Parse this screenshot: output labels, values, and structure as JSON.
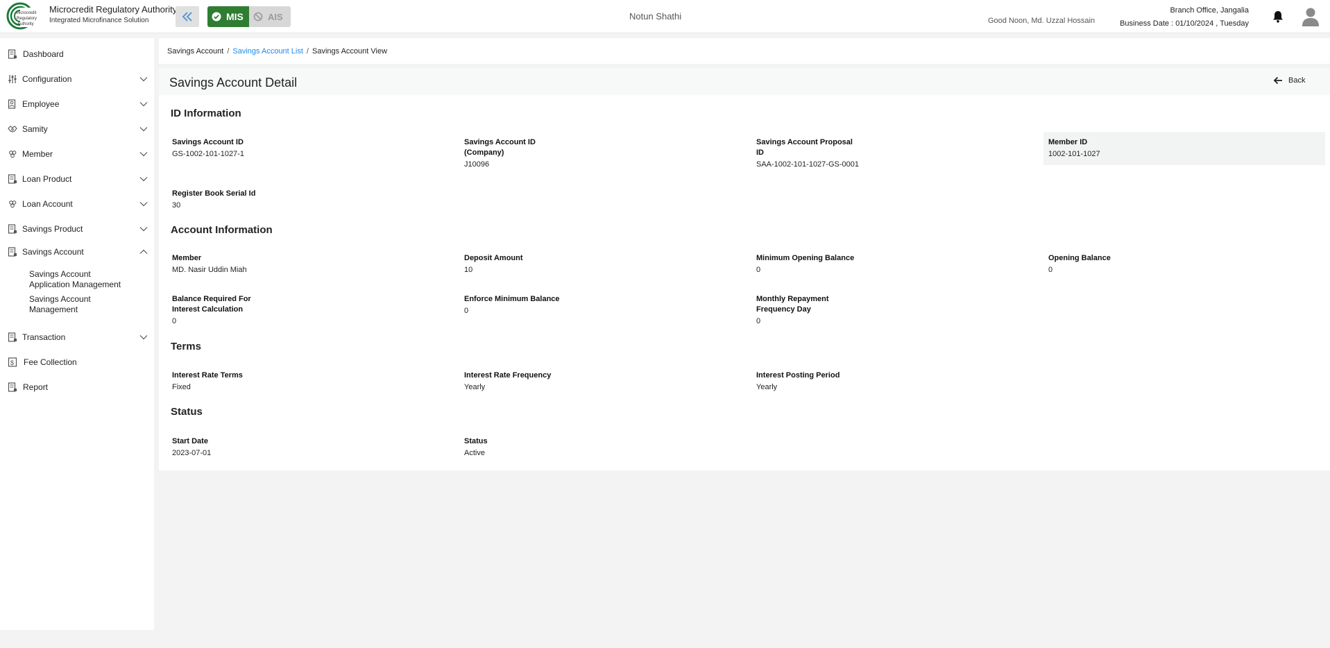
{
  "header": {
    "brand_title": "Microcredit Regulatory Authority",
    "brand_subtitle": "Integrated Microfinance Solution",
    "logo_text": [
      "Microcredit",
      "Regulatory",
      "Authority"
    ],
    "mis_label": "MIS",
    "ais_label": "AIS",
    "org_name": "Notun Shathi",
    "greeting": "Good Noon, Md. Uzzal Hossain",
    "branch": "Branch Office, Jangalia",
    "business_date": "Business Date : 01/10/2024 , Tuesday",
    "colors": {
      "mis_green": "#2e7d32",
      "logo_green": "#1b7a3a",
      "link_blue": "#1e88e5"
    }
  },
  "sidebar": {
    "items": [
      {
        "label": "Dashboard",
        "icon": "dashboard-icon",
        "chevron": ""
      },
      {
        "label": "Configuration",
        "icon": "sliders-icon",
        "chevron": "down"
      },
      {
        "label": "Employee",
        "icon": "employee-icon",
        "chevron": "down"
      },
      {
        "label": "Samity",
        "icon": "handshake-icon",
        "chevron": "down"
      },
      {
        "label": "Member",
        "icon": "group-icon",
        "chevron": "down"
      },
      {
        "label": "Loan Product",
        "icon": "document-icon",
        "chevron": "down"
      },
      {
        "label": "Loan Account",
        "icon": "group-icon",
        "chevron": "down"
      },
      {
        "label": "Savings Product",
        "icon": "document-icon",
        "chevron": "down"
      },
      {
        "label": "Savings Account",
        "icon": "document-icon",
        "chevron": "up"
      },
      {
        "label": "Transaction",
        "icon": "document-icon",
        "chevron": "down"
      },
      {
        "label": "Fee Collection",
        "icon": "fee-icon",
        "chevron": ""
      },
      {
        "label": "Report",
        "icon": "report-icon",
        "chevron": ""
      }
    ],
    "sub_items": [
      {
        "line1": "Savings Account",
        "line2": "Application Management"
      },
      {
        "line1": "Savings Account",
        "line2": "Management"
      }
    ]
  },
  "breadcrumb": {
    "root": "Savings Account",
    "link": "Savings Account List",
    "current": "Savings Account View",
    "separator": "/"
  },
  "detail": {
    "title": "Savings Account Detail",
    "back_label": "Back",
    "sections": {
      "id_info": "ID Information",
      "account_info": "Account Information",
      "terms": "Terms",
      "status": "Status"
    },
    "id_info": {
      "savings_account_id": {
        "label": "Savings Account ID",
        "value": "GS-1002-101-1027-1"
      },
      "savings_account_id_company": {
        "label1": "Savings Account ID",
        "label2": "(Company)",
        "value": "J10096"
      },
      "savings_account_proposal_id": {
        "label1": "Savings Account Proposal",
        "label2": "ID",
        "value": "SAA-1002-101-1027-GS-0001"
      },
      "member_id": {
        "label": "Member ID",
        "value": "1002-101-1027"
      },
      "register_book_serial_id": {
        "label": "Register Book Serial Id",
        "value": "30"
      }
    },
    "account_info": {
      "member": {
        "label": "Member",
        "value": "MD. Nasir Uddin Miah"
      },
      "deposit_amount": {
        "label": "Deposit Amount",
        "value": "10"
      },
      "minimum_opening_balance": {
        "label": "Minimum Opening Balance",
        "value": "0"
      },
      "opening_balance": {
        "label": "Opening Balance",
        "value": "0"
      },
      "balance_required": {
        "label1": "Balance Required For",
        "label2": "Interest Calculation",
        "value": "0"
      },
      "enforce_minimum_balance": {
        "label": "Enforce Minimum Balance",
        "value": "0"
      },
      "monthly_repayment": {
        "label1": "Monthly Repayment",
        "label2": "Frequency Day",
        "value": "0"
      }
    },
    "terms": {
      "interest_rate_terms": {
        "label": "Interest Rate Terms",
        "value": "Fixed"
      },
      "interest_rate_frequency": {
        "label": "Interest Rate Frequency",
        "value": "Yearly"
      },
      "interest_posting_period": {
        "label": "Interest Posting Period",
        "value": "Yearly"
      }
    },
    "status": {
      "start_date": {
        "label": "Start Date",
        "value": "2023-07-01"
      },
      "status": {
        "label": "Status",
        "value": "Active"
      }
    }
  }
}
